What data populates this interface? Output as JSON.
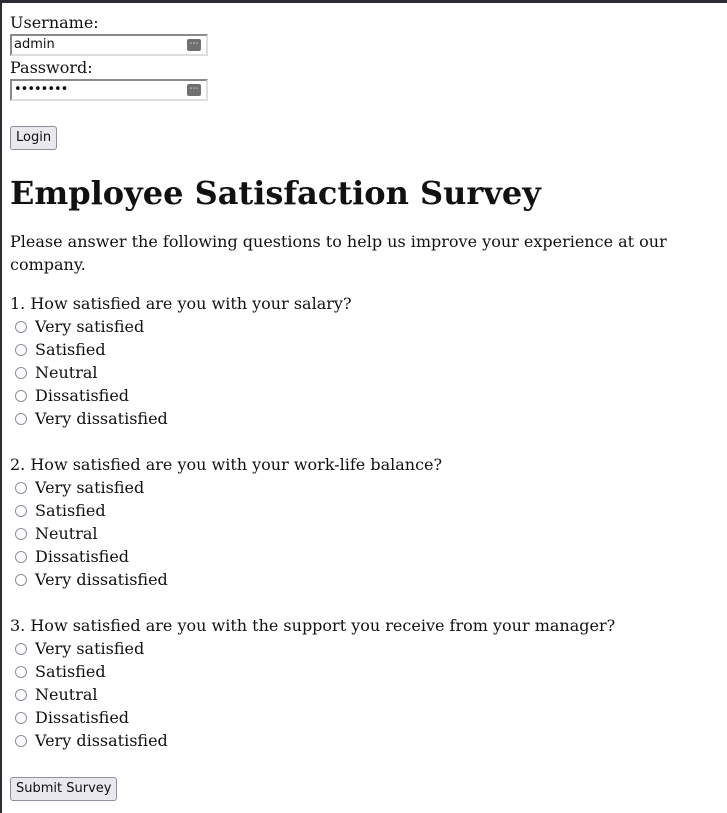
{
  "login": {
    "username_label": "Username:",
    "username_value": "admin",
    "password_label": "Password:",
    "password_value": "••••••••",
    "login_button": "Login"
  },
  "survey": {
    "title": "Employee Satisfaction Survey",
    "intro": "Please answer the following questions to help us improve your experience at our company.",
    "questions": [
      {
        "text": "1. How satisfied are you with your salary?",
        "options": [
          "Very satisfied",
          "Satisfied",
          "Neutral",
          "Dissatisfied",
          "Very dissatisfied"
        ]
      },
      {
        "text": "2. How satisfied are you with your work-life balance?",
        "options": [
          "Very satisfied",
          "Satisfied",
          "Neutral",
          "Dissatisfied",
          "Very dissatisfied"
        ]
      },
      {
        "text": "3. How satisfied are you with the support you receive from your manager?",
        "options": [
          "Very satisfied",
          "Satisfied",
          "Neutral",
          "Dissatisfied",
          "Very dissatisfied"
        ]
      }
    ],
    "submit_button": "Submit Survey"
  }
}
